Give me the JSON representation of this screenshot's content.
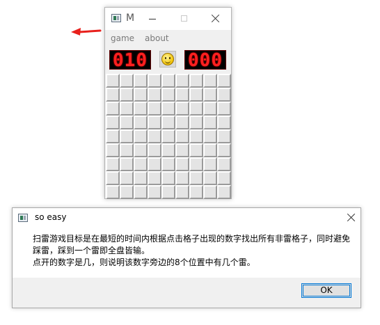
{
  "minesweeper": {
    "title": "M",
    "menu": {
      "game": "game",
      "about": "about"
    },
    "mine_counter": "010",
    "timer": "000",
    "face_icon": "smiley-face-icon",
    "grid": {
      "rows": 9,
      "cols": 9
    }
  },
  "annotation": {
    "arrow_color": "#e8201c"
  },
  "dialog": {
    "title": "so easy",
    "line1": "扫雷游戏目标是在最短的时间内根据点击格子出现的数字找出所有非雷格子，同时避免",
    "line2": "踩雷，踩到一个雷即全盘皆输。",
    "line3": "点开的数字是几，则说明该数字旁边的8个位置中有几个雷。",
    "ok_label": "OK"
  },
  "colors": {
    "led_bg": "#000000",
    "led_digit": "#ff2020",
    "ok_border": "#0078d7"
  }
}
